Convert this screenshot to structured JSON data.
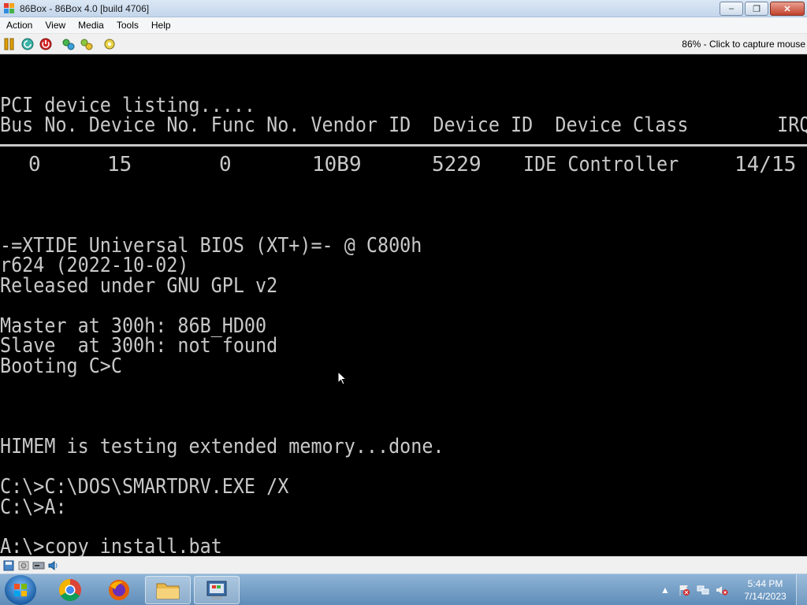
{
  "window": {
    "title": "86Box - 86Box 4.0 [build 4706]",
    "minimize_label": "–",
    "restore_label": "❐",
    "close_label": "✕"
  },
  "menu": {
    "items": [
      "Action",
      "View",
      "Media",
      "Tools",
      "Help"
    ]
  },
  "toolbar": {
    "status": "86% - Click to capture mouse"
  },
  "screen": {
    "lines": {
      "pci_title": "PCI device listing.....",
      "pci_header": "Bus No. Device No. Func No. Vendor ID  Device ID  Device Class        IRQ",
      "xtide_title": "-=XTIDE Universal BIOS (XT+)=- @ C800h",
      "xtide_version": "r624 (2022-10-02)",
      "xtide_license": "Released under GNU GPL v2",
      "master": "Master at 300h: 86B_HD00",
      "slave": "Slave  at 300h: not found",
      "booting": "Booting C>C",
      "himem": "HIMEM is testing extended memory...done.",
      "smartdrv": "C:\\>C:\\DOS\\SMARTDRV.EXE /X",
      "drive_a": "C:\\>A:",
      "copy": "A:\\>copy install.bat"
    },
    "pci_row": {
      "bus": "0",
      "device": "15",
      "func": "0",
      "vendor": "10B9",
      "device_id": "5229",
      "class": "IDE Controller",
      "irq": "14/15"
    }
  },
  "taskbar": {
    "time": "5:44 PM",
    "date": "7/14/2023",
    "tray_arrow": "▲"
  },
  "colors": {
    "screen_text": "#c8c8c8",
    "screen_bg": "#000000",
    "taskbar": "#6a97c2"
  }
}
